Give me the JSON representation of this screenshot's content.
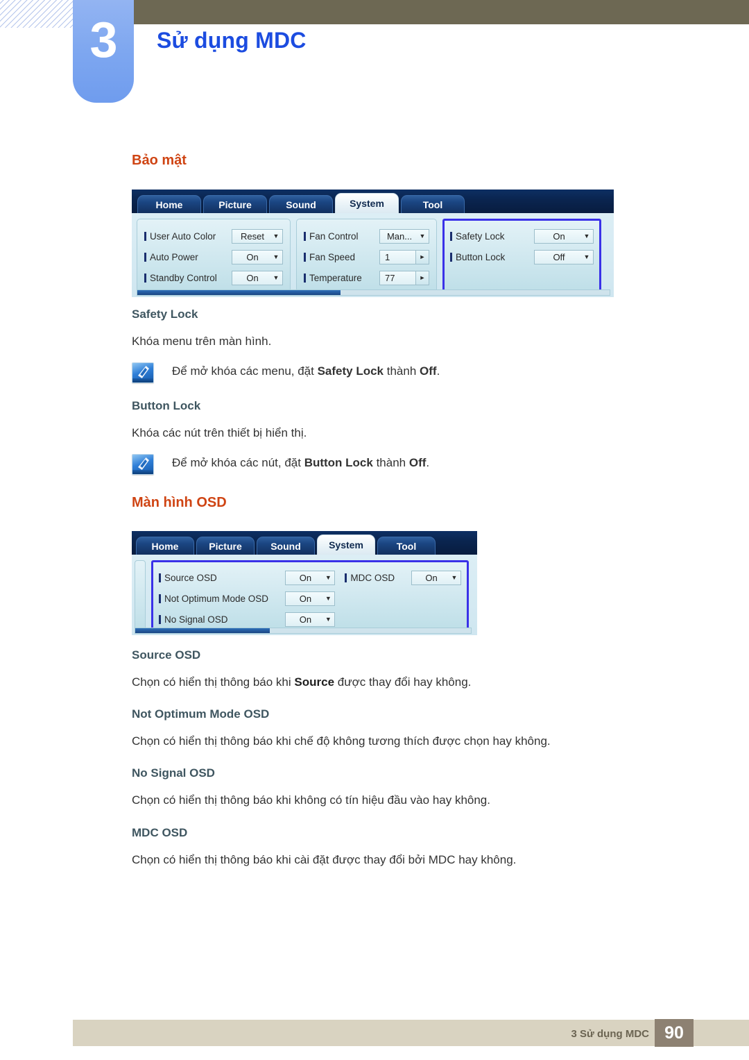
{
  "header": {
    "chapter_number": "3",
    "chapter_title": "Sử dụng MDC"
  },
  "sections": [
    {
      "heading": "Bảo mật",
      "subsections": [
        {
          "title": "Safety Lock",
          "body": "Khóa menu trên màn hình.",
          "note_prefix": "Để mở khóa các menu, đặt ",
          "note_bold1": "Safety Lock",
          "note_middle": " thành ",
          "note_bold2": "Off",
          "note_suffix": "."
        },
        {
          "title": "Button Lock",
          "body": "Khóa các nút trên thiết bị hiển thị.",
          "note_prefix": "Để mở khóa các nút, đặt ",
          "note_bold1": "Button Lock",
          "note_middle": " thành ",
          "note_bold2": "Off",
          "note_suffix": "."
        }
      ]
    },
    {
      "heading": "Màn hình OSD",
      "subsections": [
        {
          "title": "Source OSD",
          "body_prefix": "Chọn có hiển thị thông báo khi ",
          "body_bold": "Source",
          "body_suffix": " được thay đổi hay không."
        },
        {
          "title": "Not Optimum Mode OSD",
          "body": "Chọn có hiển thị thông báo khi chế độ không tương thích được chọn hay không."
        },
        {
          "title": "No Signal OSD",
          "body": "Chọn có hiển thị thông báo khi không có tín hiệu đầu vào hay không."
        },
        {
          "title": "MDC OSD",
          "body": "Chọn có hiển thị thông báo khi cài đặt được thay đổi bởi MDC hay không."
        }
      ]
    }
  ],
  "screenshot_system": {
    "tabs": [
      {
        "label": "Home",
        "active": false
      },
      {
        "label": "Picture",
        "active": false
      },
      {
        "label": "Sound",
        "active": false
      },
      {
        "label": "System",
        "active": true
      },
      {
        "label": "Tool",
        "active": false
      }
    ],
    "group_left": [
      {
        "label": "User Auto Color",
        "value": "Reset",
        "control": "dropdown"
      },
      {
        "label": "Auto Power",
        "value": "On",
        "control": "dropdown"
      },
      {
        "label": "Standby Control",
        "value": "On",
        "control": "dropdown"
      }
    ],
    "group_middle": [
      {
        "label": "Fan Control",
        "value": "Man...",
        "control": "dropdown"
      },
      {
        "label": "Fan Speed",
        "value": "1",
        "control": "spinner"
      },
      {
        "label": "Temperature",
        "value": "77",
        "control": "spinner"
      }
    ],
    "group_right": [
      {
        "label": "Safety Lock",
        "value": "On",
        "control": "dropdown"
      },
      {
        "label": "Button Lock",
        "value": "Off",
        "control": "dropdown"
      }
    ],
    "highlight_color": "#3a31e8"
  },
  "screenshot_osd": {
    "tabs": [
      {
        "label": "Home",
        "active": false
      },
      {
        "label": "Picture",
        "active": false
      },
      {
        "label": "Sound",
        "active": false
      },
      {
        "label": "System",
        "active": true
      },
      {
        "label": "Tool",
        "active": false
      }
    ],
    "group_left": [
      {
        "label": "Source OSD",
        "value": "On",
        "control": "dropdown"
      },
      {
        "label": "Not Optimum Mode OSD",
        "value": "On",
        "control": "dropdown"
      },
      {
        "label": "No Signal OSD",
        "value": "On",
        "control": "dropdown"
      }
    ],
    "group_right": [
      {
        "label": "MDC OSD",
        "value": "On",
        "control": "dropdown"
      }
    ],
    "highlight_color": "#3a31e8"
  },
  "footer": {
    "text": "3 Sử dụng MDC",
    "page": "90"
  },
  "icons": {
    "caret_down": "▼",
    "caret_right": "►"
  }
}
